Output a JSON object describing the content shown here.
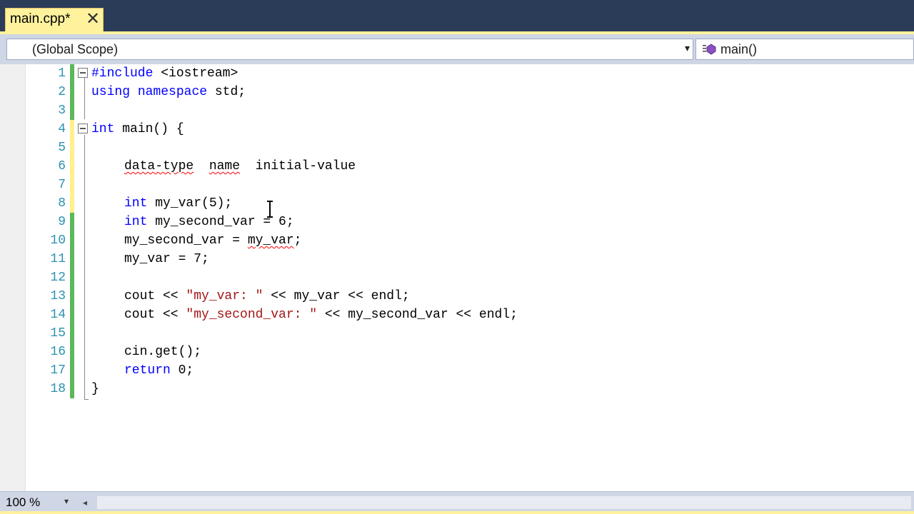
{
  "tab": {
    "title": "main.cpp*",
    "close": "✕"
  },
  "navbar": {
    "scope": "(Global Scope)",
    "member": "main()",
    "dropdown_arrow": "▾"
  },
  "editor": {
    "lines": [
      {
        "n": "1"
      },
      {
        "n": "2"
      },
      {
        "n": "3"
      },
      {
        "n": "4"
      },
      {
        "n": "5"
      },
      {
        "n": "6"
      },
      {
        "n": "7"
      },
      {
        "n": "8"
      },
      {
        "n": "9"
      },
      {
        "n": "10"
      },
      {
        "n": "11"
      },
      {
        "n": "12"
      },
      {
        "n": "13"
      },
      {
        "n": "14"
      },
      {
        "n": "15"
      },
      {
        "n": "16"
      },
      {
        "n": "17"
      },
      {
        "n": "18"
      }
    ],
    "code": {
      "l1_pp": "#include",
      "l1_rest": " <iostream>",
      "l2_kw1": "using",
      "l2_kw2": "namespace",
      "l2_rest": " std;",
      "l4_kw": "int",
      "l4_rest": " main() {",
      "l6_a": "data-type",
      "l6_b": "name",
      "l6_c": "initial-value",
      "l8_kw": "int",
      "l8_rest": " my_var(5);",
      "l9_kw": "int",
      "l9_rest": " my_second_var = 6;",
      "l10_a": "my_second_var = ",
      "l10_b": "my_var",
      "l10_c": ";",
      "l11": "my_var = 7;",
      "l13_a": "cout << ",
      "l13_str": "\"my_var: \"",
      "l13_b": " << my_var << endl;",
      "l14_a": "cout << ",
      "l14_str": "\"my_second_var: \"",
      "l14_b": " << my_second_var << endl;",
      "l16": "cin.get();",
      "l17_kw": "return",
      "l17_rest": " 0;",
      "l18": "}"
    },
    "change_colors": {
      "saved": "#5bb85b",
      "unsaved": "#fff08c"
    }
  },
  "statusbar": {
    "zoom": "100 %",
    "scroll_left": "◂"
  }
}
